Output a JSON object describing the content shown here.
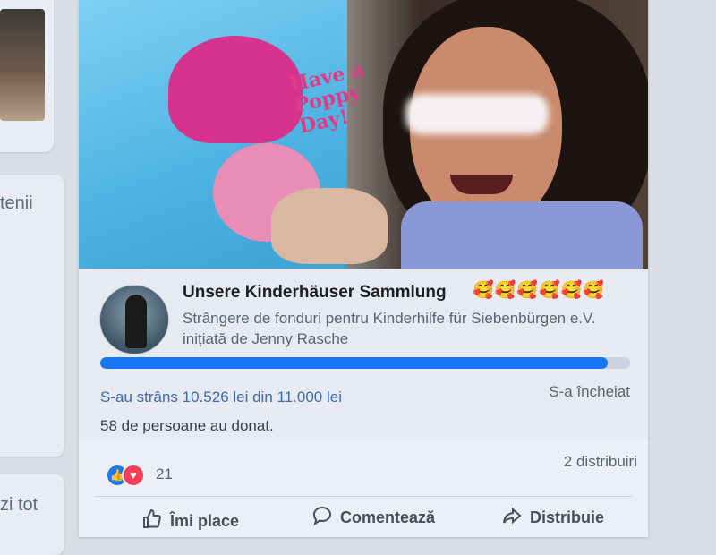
{
  "left_column": {
    "text_1": "tenii",
    "text_2": "zi tot"
  },
  "post": {
    "photo": {
      "shirt_text": "Have a Poppy Day!"
    },
    "fundraiser": {
      "title": "Unsere Kinderhäuser Sammlung",
      "emojis": "🥰🥰🥰🥰🥰🥰",
      "description": "Strângere de fonduri pentru Kinderhilfe für Siebenbürgen e.V. inițiată de Jenny Rasche",
      "progress_fraction": 0.957,
      "raised_text": "S-au strâns 10.526 lei din 11.000 lei",
      "status": "S-a încheiat",
      "donors_text": "58 de persoane au donat."
    },
    "reactions": {
      "icons": [
        "like-icon",
        "love-icon"
      ],
      "count": "21",
      "shares": "2 distribuiri"
    },
    "actions": {
      "like_label": "Îmi place",
      "comment_label": "Comentează",
      "share_label": "Distribuie"
    }
  },
  "colors": {
    "accent": "#1877f2",
    "love": "#f33e58",
    "background": "#d9dde6"
  }
}
